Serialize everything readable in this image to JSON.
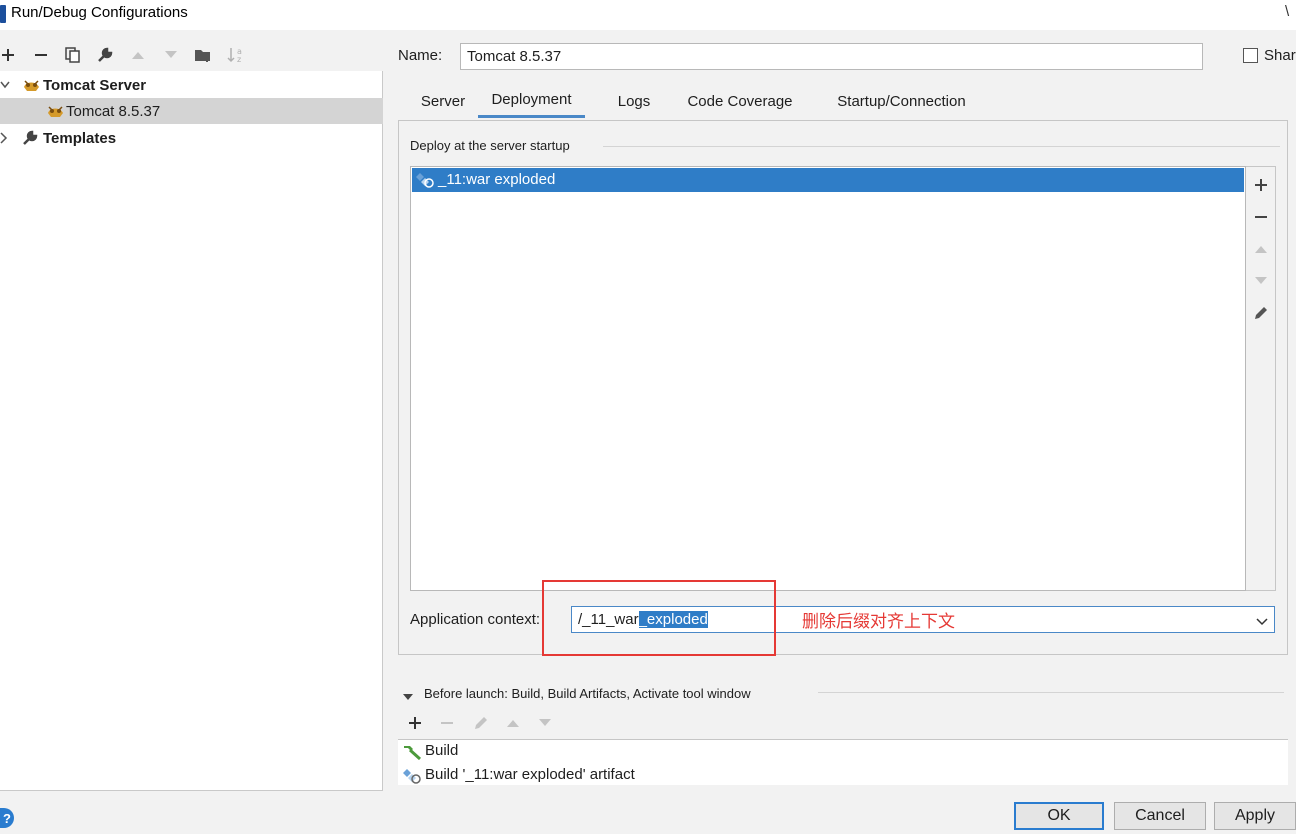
{
  "window": {
    "title": "Run/Debug Configurations",
    "close_glyph": "\\"
  },
  "left_toolbar": [
    "add-icon",
    "remove-icon",
    "copy-icon",
    "wrench-icon",
    "move-up-icon",
    "move-down-icon",
    "folder-add-icon",
    "sort-alpha-icon"
  ],
  "tree": {
    "group_label": "Tomcat Server",
    "config_label": "Tomcat 8.5.37",
    "templates_label": "Templates"
  },
  "config": {
    "name_label": "Name:",
    "name_value": "Tomcat 8.5.37",
    "share_label": "Share"
  },
  "tabs": [
    "Server",
    "Deployment",
    "Logs",
    "Code Coverage",
    "Startup/Connection"
  ],
  "active_tab": "Deployment",
  "deployment": {
    "section_title": "Deploy at the server startup",
    "items": [
      "_11:war exploded"
    ],
    "context_label": "Application context:",
    "context_value_plain": "/_11_war",
    "context_value_selected": "_exploded",
    "annotation": "删除后缀对齐上下文"
  },
  "before_launch": {
    "label": "Before launch: Build, Build Artifacts, Activate tool window",
    "tasks": [
      "Build",
      "Build '_11:war exploded' artifact"
    ]
  },
  "buttons": {
    "help": "?",
    "ok": "OK",
    "cancel": "Cancel",
    "apply": "Apply"
  },
  "colors": {
    "accent": "#2f7dc7",
    "annotation": "#e53935",
    "selection_tree": "#d4d4d4"
  }
}
